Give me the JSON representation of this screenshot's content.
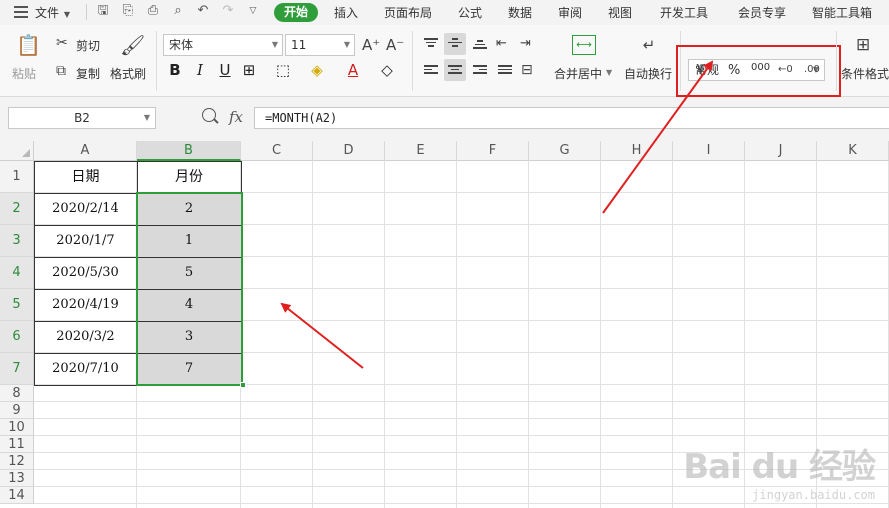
{
  "menubar": {
    "file_label": "文件",
    "tabs": [
      "开始",
      "插入",
      "页面布局",
      "公式",
      "数据",
      "审阅",
      "视图",
      "开发工具",
      "会员专享",
      "智能工具箱"
    ]
  },
  "ribbon": {
    "paste": "粘贴",
    "cut": "剪切",
    "copy": "复制",
    "format_painter": "格式刷",
    "font_name": "宋体",
    "font_size": "11",
    "merge_center": "合并居中",
    "wrap_text": "自动换行",
    "number_format": "常规",
    "percent": "%",
    "thousands": "000",
    "conditional_format": "条件格式"
  },
  "formula_bar": {
    "name_box": "B2",
    "fx": "fx",
    "formula": "=MONTH(A2)"
  },
  "grid": {
    "columns": [
      "A",
      "B",
      "C",
      "D",
      "E",
      "F",
      "G",
      "H",
      "I",
      "J",
      "K"
    ],
    "rows": [
      "1",
      "2",
      "3",
      "4",
      "5",
      "6",
      "7",
      "8",
      "9",
      "10",
      "11",
      "12",
      "13",
      "14"
    ],
    "header_date": "日期",
    "header_month": "月份",
    "dates": [
      "2020/2/14",
      "2020/1/7",
      "2020/5/30",
      "2020/4/19",
      "2020/3/2",
      "2020/7/10"
    ],
    "months": [
      "2",
      "1",
      "5",
      "4",
      "3",
      "7"
    ]
  },
  "watermark": {
    "brand": "Bai du 经验",
    "url": "jingyan.baidu.com"
  },
  "colors": {
    "accent_green": "#2e9d3a",
    "annotation_red": "#e02020",
    "selection_fill": "#d9d9d9"
  }
}
